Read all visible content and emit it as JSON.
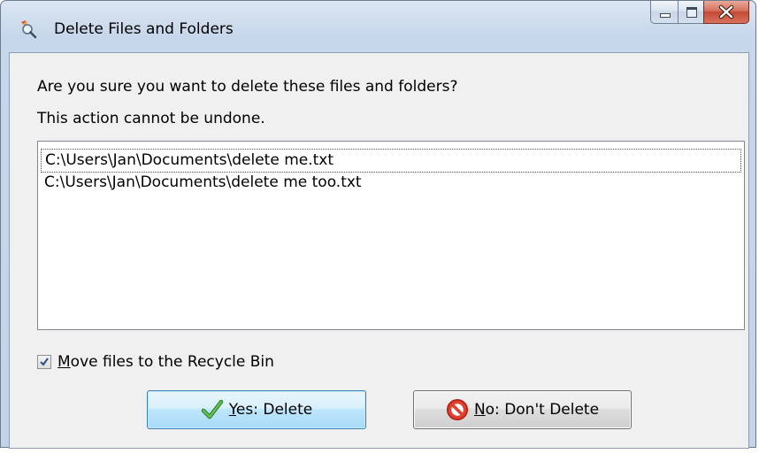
{
  "window": {
    "title": "Delete Files and Folders",
    "app_icon": "magnifier-icon"
  },
  "caption_buttons": {
    "minimize_icon": "minimize-icon",
    "maximize_icon": "maximize-icon",
    "close_icon": "close-icon"
  },
  "dialog": {
    "message_line1": "Are you sure you want to delete these files and folders?",
    "message_line2": "This action cannot be undone."
  },
  "file_list": {
    "items": [
      "C:\\Users\\Jan\\Documents\\delete me.txt",
      "C:\\Users\\Jan\\Documents\\delete me too.txt"
    ]
  },
  "recycle_checkbox": {
    "checked": true,
    "access_key": "M",
    "label_rest": "ove files to the Recycle Bin"
  },
  "buttons": {
    "yes": {
      "icon": "checkmark-icon",
      "access_key": "Y",
      "label_rest": "es: Delete"
    },
    "no": {
      "icon": "no-entry-icon",
      "access_key": "N",
      "label_rest": "o: Don't Delete"
    }
  },
  "colors": {
    "yes_border": "#3c7fb1",
    "check_green": "#3aa335",
    "no_red": "#d8261a",
    "close_red": "#c24a34"
  }
}
